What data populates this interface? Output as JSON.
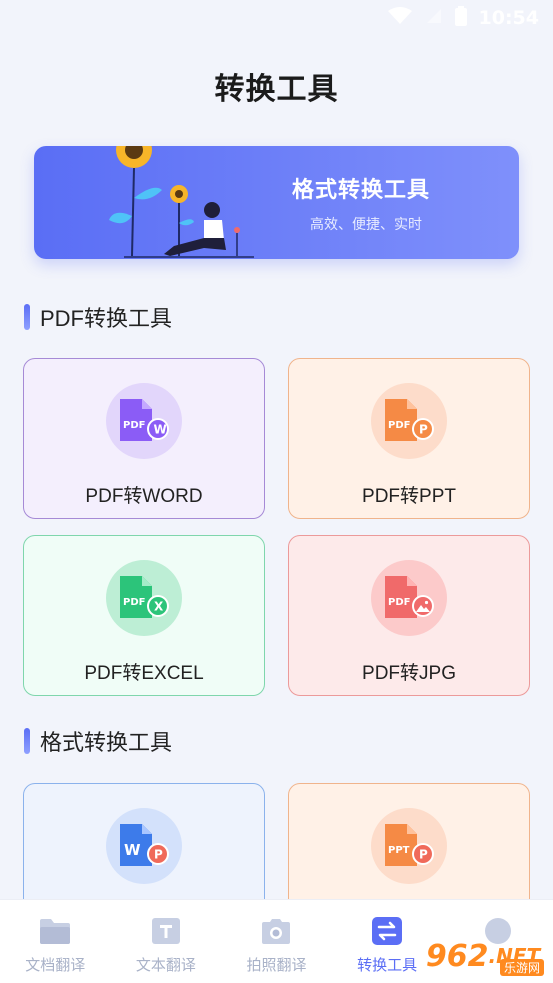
{
  "status_bar": {
    "time": "10:54"
  },
  "page_title": "转换工具",
  "banner": {
    "title": "格式转换工具",
    "subtitle": "高效、便捷、实时"
  },
  "sections": [
    {
      "title": "PDF转换工具"
    },
    {
      "title": "格式转换工具"
    }
  ],
  "pdf_tools": [
    {
      "label": "PDF转WORD",
      "icon": "pdf-to-word-icon",
      "badge": "W",
      "color": "#8b5cf6"
    },
    {
      "label": "PDF转PPT",
      "icon": "pdf-to-ppt-icon",
      "badge": "P",
      "color": "#f58a45"
    },
    {
      "label": "PDF转EXCEL",
      "icon": "pdf-to-excel-icon",
      "badge": "X",
      "color": "#2cc47a"
    },
    {
      "label": "PDF转JPG",
      "icon": "pdf-to-jpg-icon",
      "badge": "",
      "color": "#f06a6a"
    }
  ],
  "format_tools": [
    {
      "icon": "word-to-ppt-icon",
      "badge_left": "W",
      "badge": "P",
      "color": "#3d7bea"
    },
    {
      "icon": "ppt-to-pdf-icon",
      "doc_text": "PPT",
      "badge": "P",
      "color": "#f58a45"
    }
  ],
  "doc_text": {
    "pdf": "PDF"
  },
  "bottom_nav": [
    {
      "label": "文档翻译",
      "icon": "folder-icon",
      "active": false
    },
    {
      "label": "文本翻译",
      "icon": "text-icon",
      "active": false
    },
    {
      "label": "拍照翻译",
      "icon": "camera-icon",
      "active": false
    },
    {
      "label": "转换工具",
      "icon": "convert-icon",
      "active": true
    },
    {
      "label": "",
      "icon": "profile-icon",
      "active": false
    }
  ],
  "watermark": {
    "text": "962",
    "suffix": ".NET",
    "sub": "乐游网"
  },
  "colors": {
    "accent": "#5b6ef5",
    "nav_inactive": "#a9b2c8"
  }
}
